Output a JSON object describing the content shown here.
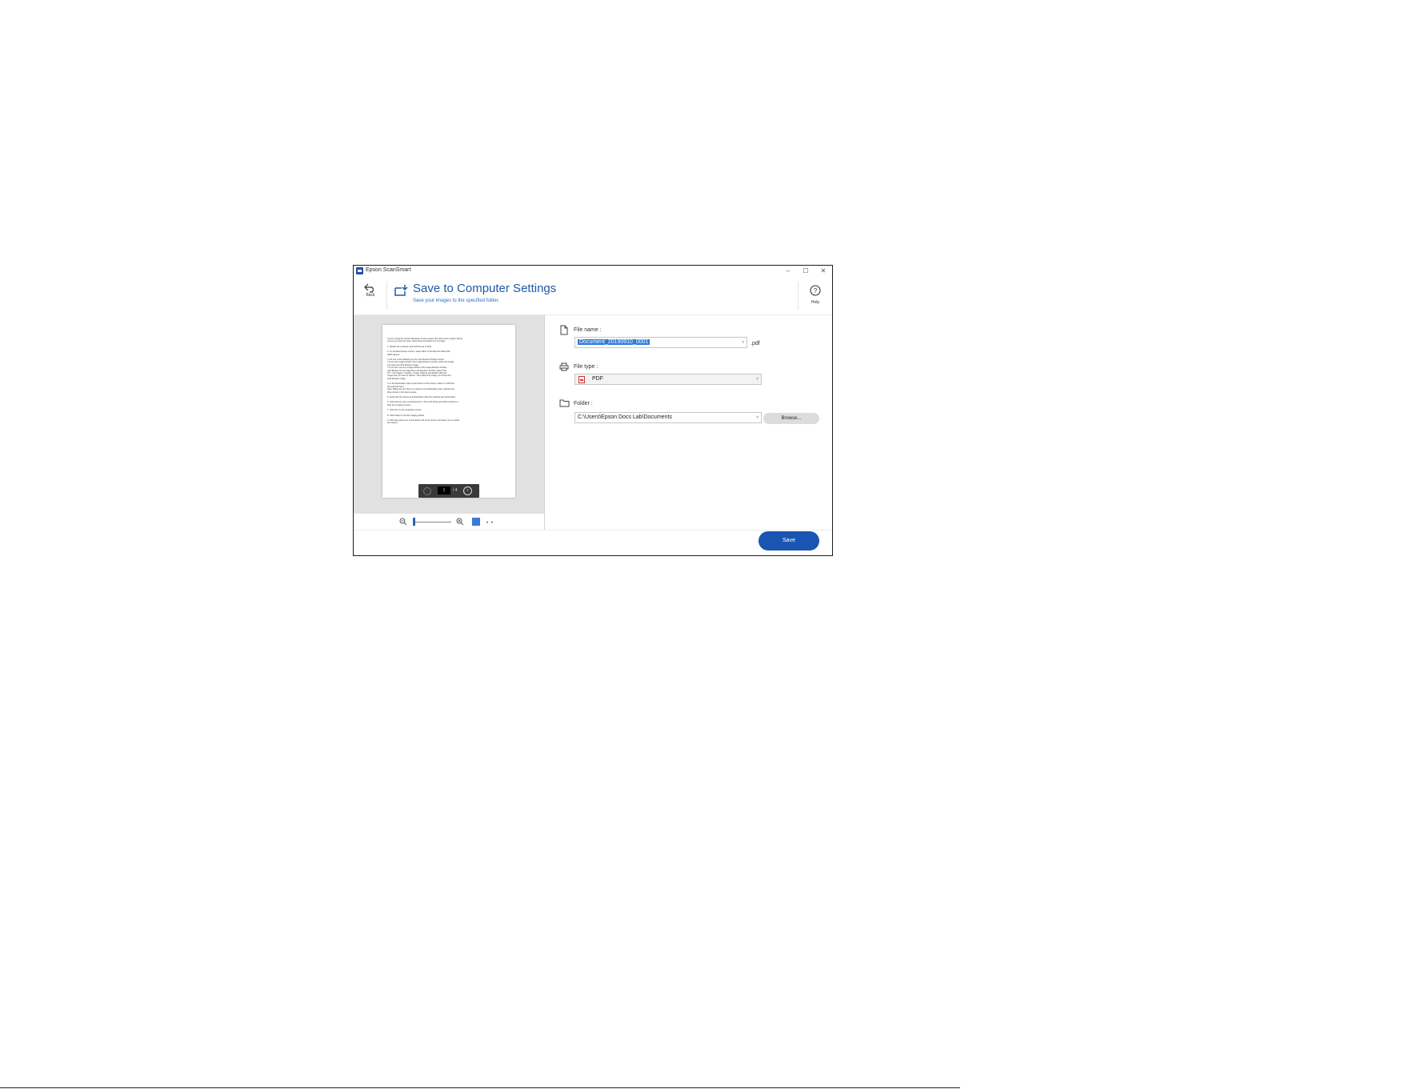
{
  "window": {
    "app_title": "Epson ScanSmart",
    "controls": {
      "minimize": "–",
      "maximize": "☐",
      "close": "✕"
    }
  },
  "header": {
    "back_label": "Back",
    "title": "Save to Computer Settings",
    "subtitle": "Save your images to the specified folder.",
    "help_label": "Help",
    "icons": {
      "back": "back-arrow-icon",
      "save": "save-to-computer-icon",
      "help": "help-circle-icon"
    }
  },
  "preview": {
    "document_lines": [
      "If you're using the newest Windows 10 text system (the dual-screen system facing",
      "you as you enter the site), follow these instructions to re-image:",
      "",
      "1. Restart the computer and hold F11 as it boots.",
      "",
      "2. On the Boot Device screen, select either of the Restore Plain Disk",
      "   UEFI options.",
      "",
      "3. Do one of the following on the main Restore Perfect screen:",
      "   • If you see images listed in the Image Restore window, select the image",
      "     you want and click Restore Image.",
      "   • If you don't see any images listed in the Image Restore window,",
      "     click Browse for an image file in the Explorer window, select This",
      "     PC > C6 Images > Testing > Tester Capture and double-click the",
      "     image that you want to restore. Then select the image you chose and",
      "     click Restore Image.",
      "",
      "4. In the Destination pane at the bottom of the screen, select 0: 128 Drive",
      "   (R) and click Next.",
      "   Note: Make sure the drive you select in the Destination pane matches the",
      "   drive shown in the Source pane.",
      "",
      "5. Verify that the source and destination disk info matches and click Finish.",
      "",
      "6. Verify that you are overwriting the C: drive (OS Drive) and click Continue to",
      "   start the imaging process.",
      "",
      "7. Click OK on the completion screen.",
      "",
      "8. Click Close to exit the imaging wizard.",
      "",
      "9. Click the power icon at the bottom left of the screen and select Yes to restart",
      "   the system."
    ],
    "pager": {
      "current": "1",
      "total": "/ 4",
      "next": "›"
    },
    "zoom": {
      "more": "• •",
      "level": 0.02
    }
  },
  "fields": {
    "file_name": {
      "label": "File name :",
      "value": "Document_20190910_0001",
      "extension": ".pdf"
    },
    "file_type": {
      "label": "File type :",
      "value": "PDF"
    },
    "folder": {
      "label": "Folder :",
      "value": "C:\\Users\\Epson Docs Lab\\Documents",
      "browse_label": "Browse..."
    }
  },
  "footer": {
    "save_label": "Save"
  },
  "colors": {
    "accent": "#1e5aa8",
    "save_button": "#1b55b2",
    "preview_bg": "#e1e1e1"
  }
}
